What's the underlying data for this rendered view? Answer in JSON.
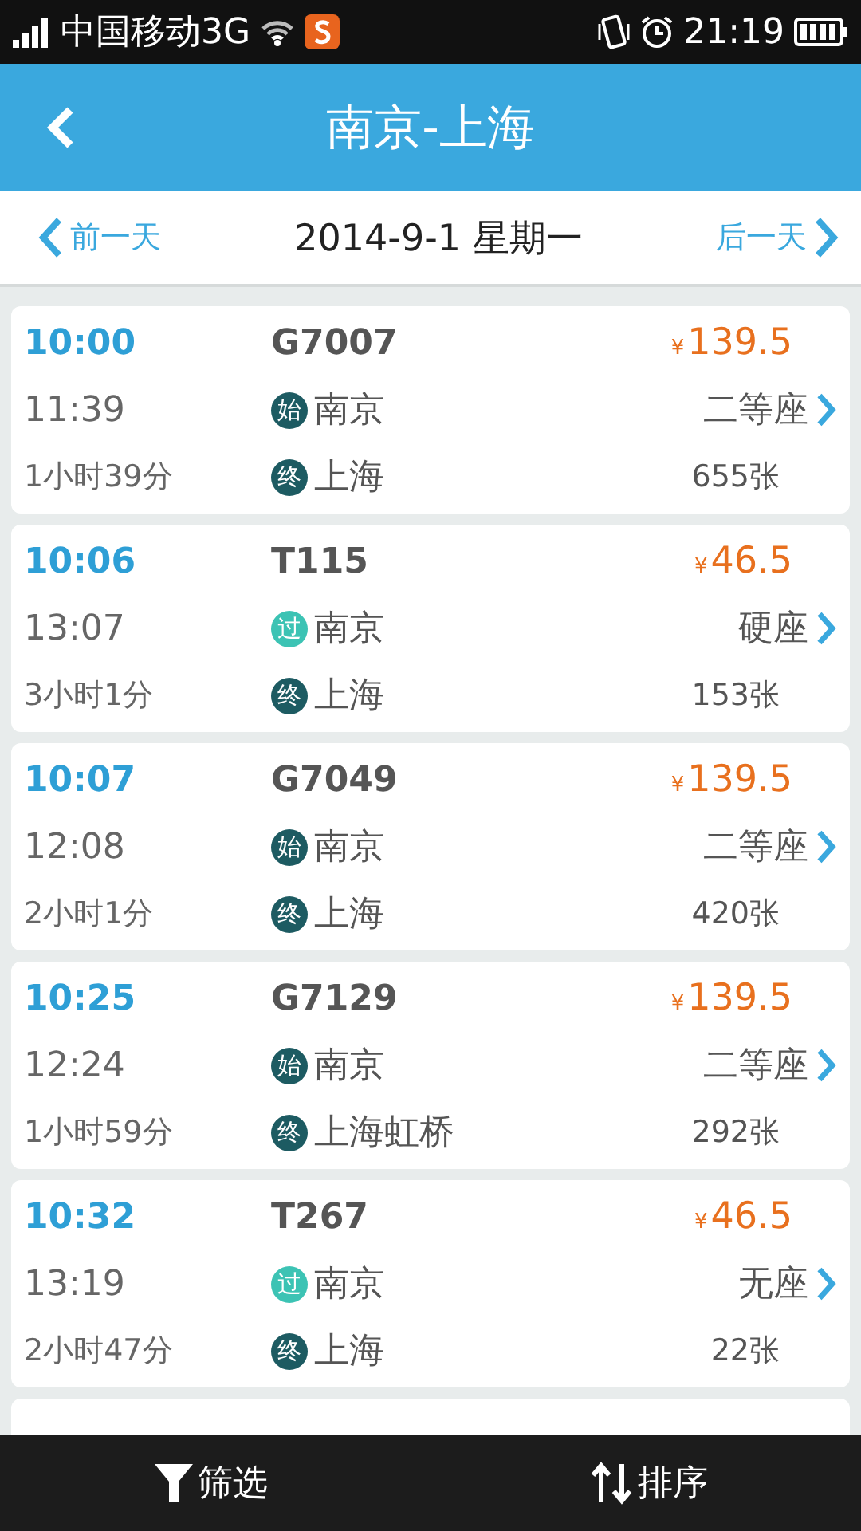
{
  "status_bar": {
    "carrier": "中国移动3G",
    "time": "21:19"
  },
  "header": {
    "title": "南京-上海"
  },
  "date_bar": {
    "prev": "前一天",
    "date": "2014-9-1 星期一",
    "next": "后一天"
  },
  "trains": [
    {
      "depart": "10:00",
      "arrive": "11:39",
      "duration": "1小时39分",
      "number": "G7007",
      "from_badge": {
        "text": "始",
        "color": "#1d5b62"
      },
      "from": "南京",
      "to_badge": {
        "text": "终",
        "color": "#1d5b62"
      },
      "to": "上海",
      "currency": "¥",
      "price": "139.5",
      "seat": "二等座",
      "tickets": "655张"
    },
    {
      "depart": "10:06",
      "arrive": "13:07",
      "duration": "3小时1分",
      "number": "T115",
      "from_badge": {
        "text": "过",
        "color": "#3cc3b4"
      },
      "from": "南京",
      "to_badge": {
        "text": "终",
        "color": "#1d5b62"
      },
      "to": "上海",
      "currency": "¥",
      "price": "46.5",
      "seat": "硬座",
      "tickets": "153张"
    },
    {
      "depart": "10:07",
      "arrive": "12:08",
      "duration": "2小时1分",
      "number": "G7049",
      "from_badge": {
        "text": "始",
        "color": "#1d5b62"
      },
      "from": "南京",
      "to_badge": {
        "text": "终",
        "color": "#1d5b62"
      },
      "to": "上海",
      "currency": "¥",
      "price": "139.5",
      "seat": "二等座",
      "tickets": "420张"
    },
    {
      "depart": "10:25",
      "arrive": "12:24",
      "duration": "1小时59分",
      "number": "G7129",
      "from_badge": {
        "text": "始",
        "color": "#1d5b62"
      },
      "from": "南京",
      "to_badge": {
        "text": "终",
        "color": "#1d5b62"
      },
      "to": "上海虹桥",
      "currency": "¥",
      "price": "139.5",
      "seat": "二等座",
      "tickets": "292张"
    },
    {
      "depart": "10:32",
      "arrive": "13:19",
      "duration": "2小时47分",
      "number": "T267",
      "from_badge": {
        "text": "过",
        "color": "#3cc3b4"
      },
      "from": "南京",
      "to_badge": {
        "text": "终",
        "color": "#1d5b62"
      },
      "to": "上海",
      "currency": "¥",
      "price": "46.5",
      "seat": "无座",
      "tickets": "22张"
    }
  ],
  "bottom_bar": {
    "filter": "筛选",
    "sort": "排序"
  }
}
